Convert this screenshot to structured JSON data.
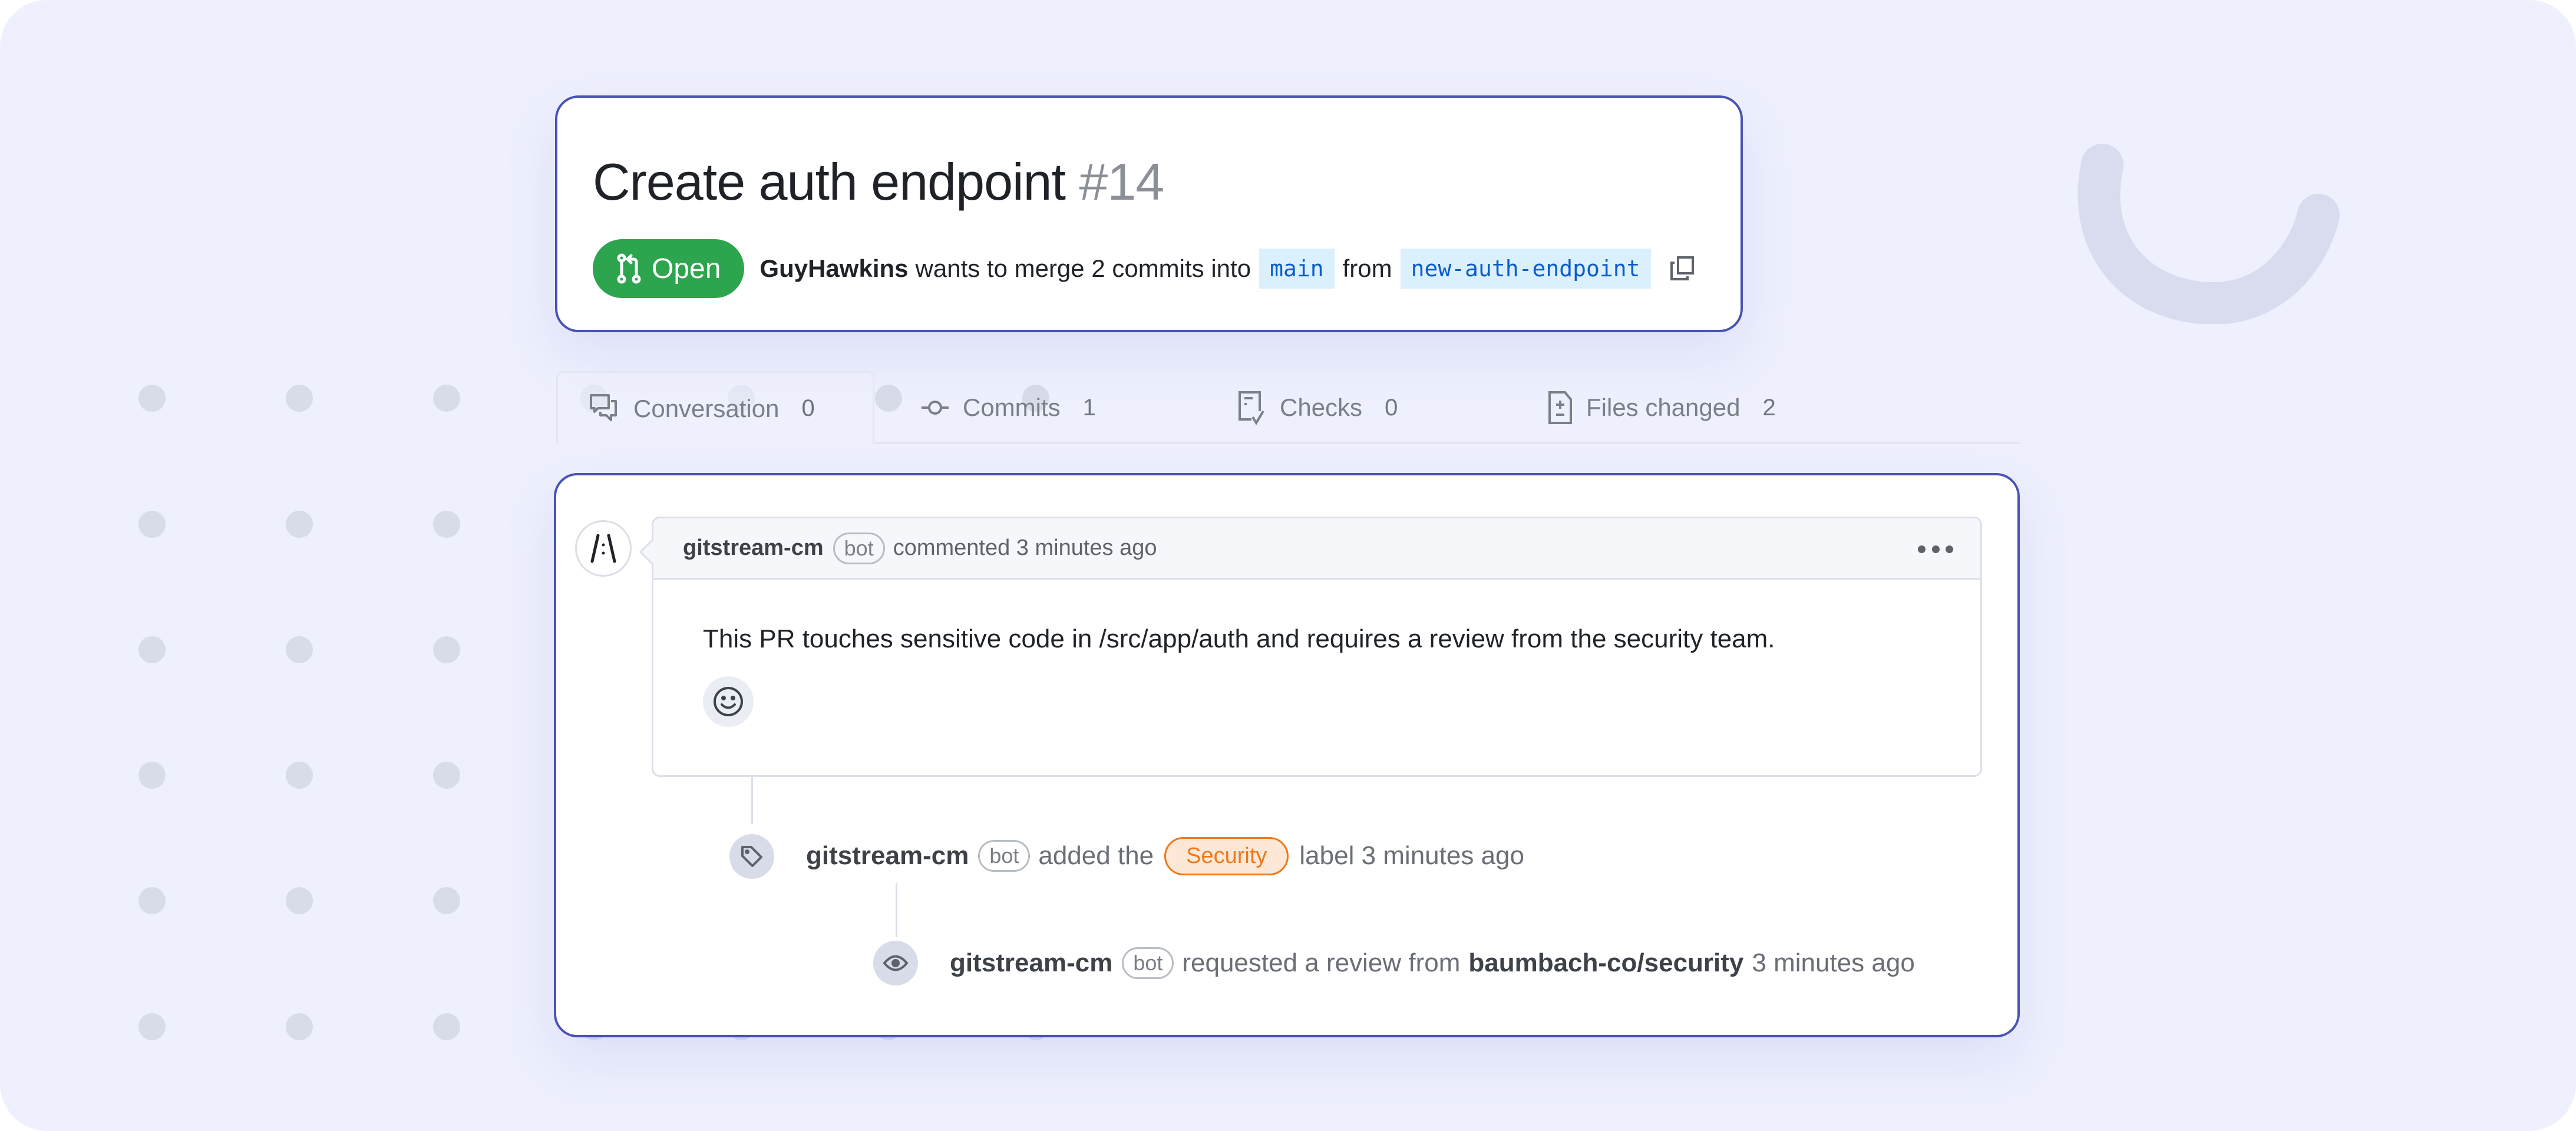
{
  "pull_request": {
    "title": "Create auth endpoint",
    "number": "#14",
    "state": "Open",
    "author": "GuyHawkins",
    "merge_text": "wants to merge 2 commits into",
    "base_branch": "main",
    "from_text": "from",
    "head_branch": "new-auth-endpoint"
  },
  "tabs": [
    {
      "label": "Conversation",
      "count": "0",
      "icon": "conversation-icon",
      "active": true
    },
    {
      "label": "Commits",
      "count": "1",
      "icon": "commit-icon",
      "active": false
    },
    {
      "label": "Checks",
      "count": "0",
      "icon": "checks-icon",
      "active": false
    },
    {
      "label": "Files changed",
      "count": "2",
      "icon": "file-diff-icon",
      "active": false
    }
  ],
  "comment": {
    "author": "gitstream-cm",
    "badge": "bot",
    "action": "commented 3 minutes ago",
    "body": "This PR touches sensitive code in /src/app/auth and requires a review from the security team."
  },
  "timeline": [
    {
      "author": "gitstream-cm",
      "badge": "bot",
      "prefix": "added the",
      "label": "Security",
      "suffix": "label 3 minutes ago",
      "icon": "tag-icon"
    },
    {
      "author": "gitstream-cm",
      "badge": "bot",
      "prefix": "requested a review from",
      "team": "baumbach-co/security",
      "suffix": "3 minutes ago",
      "icon": "eye-icon"
    }
  ],
  "colors": {
    "accent_border": "#4853b3",
    "open_green": "#2da44e",
    "branch_blue": "#0b5cc9",
    "branch_bg": "#dbf0fd",
    "label_orange": "#f07818",
    "label_bg": "#fde8d8",
    "background": "#eef0fe"
  }
}
